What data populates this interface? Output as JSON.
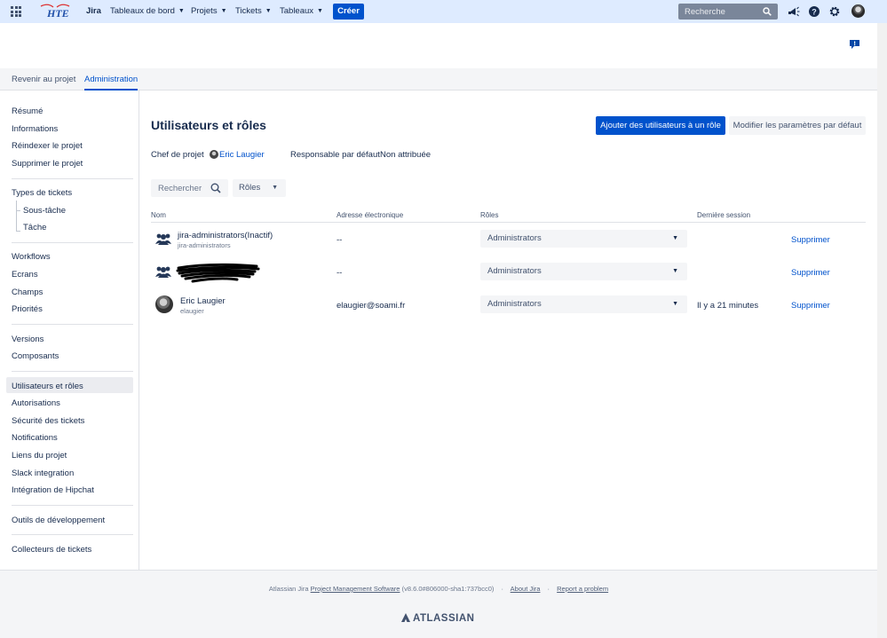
{
  "topbar": {
    "logo_text": "HTE",
    "product": "Jira",
    "nav": [
      "Tableaux de bord",
      "Projets",
      "Tickets",
      "Tableaux"
    ],
    "create_label": "Créer",
    "search_placeholder": "Recherche",
    "icons": [
      "app-switcher-icon",
      "notifications-icon",
      "help-icon",
      "settings-icon",
      "user-avatar"
    ]
  },
  "subnav": {
    "back_label": "Revenir au projet",
    "admin_label": "Administration"
  },
  "sidebar": {
    "group1": [
      "Résumé",
      "Informations",
      "Réindexer le projet",
      "Supprimer le projet"
    ],
    "group2_head": "Types de tickets",
    "group2_sub": [
      "Sous-tâche",
      "Tâche"
    ],
    "group3": [
      "Workflows",
      "Ecrans",
      "Champs",
      "Priorités"
    ],
    "group4": [
      "Versions",
      "Composants"
    ],
    "group5": [
      "Utilisateurs et rôles",
      "Autorisations",
      "Sécurité des tickets",
      "Notifications",
      "Liens du projet",
      "Slack integration",
      "Intégration de Hipchat"
    ],
    "group6": [
      "Outils de développement"
    ],
    "group7": [
      "Collecteurs de tickets"
    ],
    "selected": "Utilisateurs et rôles"
  },
  "main": {
    "title": "Utilisateurs et rôles",
    "add_button": "Ajouter des utilisateurs à un rôle",
    "defaults_button": "Modifier les paramètres par défaut",
    "lead_label": "Chef de projet",
    "lead_name": "Eric Laugier",
    "default_assignee_label": "Responsable par défaut",
    "default_assignee_value": "Non attribuée",
    "filter_search_placeholder": "Rechercher",
    "filter_roles_label": "Rôles",
    "columns": [
      "Nom",
      "Adresse électronique",
      "Rôles",
      "Dernière session"
    ],
    "rows": [
      {
        "name": "jira-administrators(Inactif)",
        "username": "jira-administrators",
        "email": "--",
        "role": "Administrators",
        "last_session": "",
        "action": "Supprimer"
      },
      {
        "name": "",
        "username": "",
        "email": "--",
        "role": "Administrators",
        "last_session": "",
        "action": "Supprimer"
      },
      {
        "name": "Eric Laugier",
        "username": "elaugier",
        "email": "elaugier@soami.fr",
        "role": "Administrators",
        "last_session": "Il y a 21 minutes",
        "action": "Supprimer"
      }
    ]
  },
  "footer": {
    "prefix": "Atlassian Jira",
    "pms": "Project Management Software",
    "version": "(v8.6.0#806000-sha1:737bcc0)",
    "about": "About Jira",
    "report": "Report a problem",
    "brand": "ATLASSIAN"
  },
  "colors": {
    "topbar": "#deebff",
    "primary": "#0052cc",
    "text": "#172b4d"
  }
}
